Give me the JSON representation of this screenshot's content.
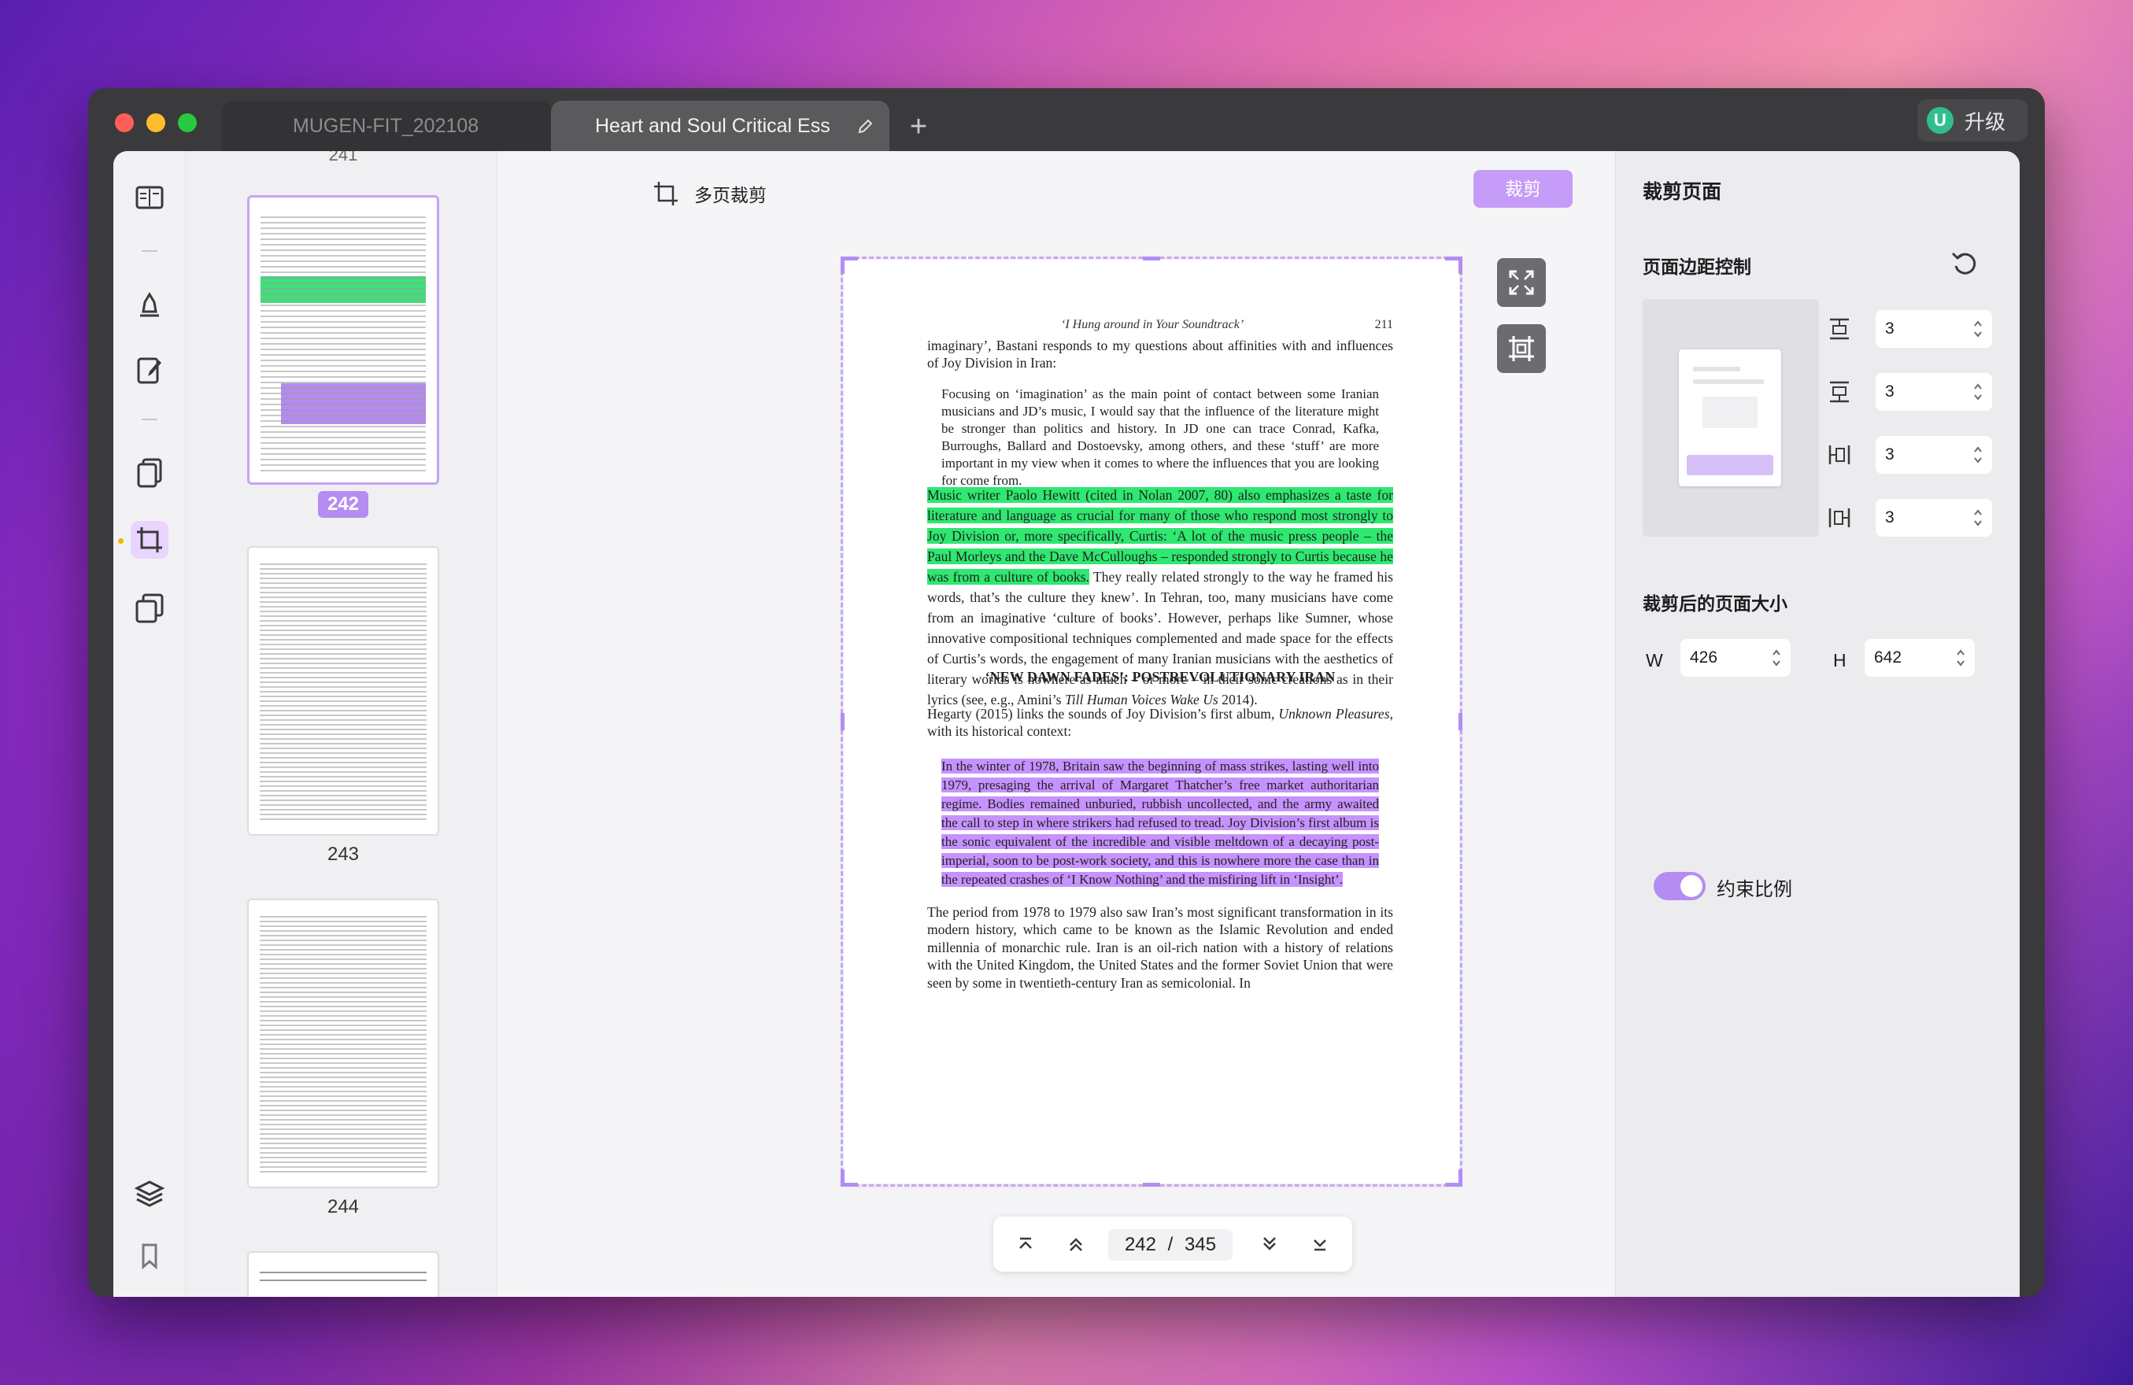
{
  "window": {
    "tabs": [
      {
        "label": "MUGEN-FIT_202108"
      },
      {
        "label": "Heart and Soul Critical Ess"
      }
    ],
    "upgrade": {
      "badge": "U",
      "label": "升级"
    }
  },
  "toolbar": {
    "title": "多页裁剪",
    "crop_button": "裁剪"
  },
  "thumbnails": {
    "top_label": "241",
    "items": [
      {
        "page": "242",
        "selected": true
      },
      {
        "page": "243",
        "selected": false
      },
      {
        "page": "244",
        "selected": false
      }
    ]
  },
  "document": {
    "running_head_title": "‘I Hung around in Your Soundtrack’",
    "running_head_page": "211",
    "para1": "imaginary’, Bastani responds to my questions about affinities with and influences of Joy Division in Iran:",
    "quote1": "Focusing on ‘imagination’ as the main point of contact between some Iranian musicians and JD’s music, I would say that the influence of the literature might be stronger than politics and history. In JD one can trace Conrad, Kafka, Burroughs, Ballard and Dostoevsky, among others, and these ‘stuff’ are more important in my view when it comes to where the influences that you are looking for come from.",
    "para2_highlight": "Music writer Paolo Hewitt (cited in Nolan 2007, 80) also emphasizes a taste for literature and language as crucial for many of those who respond most strongly to Joy Division or, more specifically, Curtis: ‘A lot of the music press people – the Paul Morleys and the Dave McCulloughs – responded strongly to Curtis because he was from a culture of books.",
    "para2_rest": " They really related strongly to the way he framed his words, that’s the culture they knew’. In Tehran, too, many musicians have come from an imaginative ‘culture of books’. However, perhaps like Sumner, whose innovative compositional techniques complemented and made space for the effects of Curtis’s words, the engagement of many Iranian musicians with the aesthetics of literary worlds is nowhere as much – or more – in their sonic creations as in their lyrics (see, e.g., Amini’s ",
    "para2_italic": "Till Human Voices Wake Us",
    "para2_end": " 2014).",
    "section_heading": "‘NEW DAWN FADES’: POSTREVOLUTIONARY IRAN",
    "para3_start": "Hegarty (2015) links the sounds of Joy Division’s first album, ",
    "para3_italic": "Unknown Pleasures",
    "para3_end": ", with its historical context:",
    "quote2_highlight": "In the winter of 1978, Britain saw the beginning of mass strikes, lasting well into 1979, presaging the arrival of Margaret Thatcher’s free market authoritarian regime. Bodies remained unburied, rubbish uncollected, and the army awaited the call to step in where strikers had refused to tread. Joy Division’s first album is the sonic equivalent of the incredible and visible meltdown of a decaying post-imperial, soon to be post-work society, and this is nowhere more the case than in the repeated crashes of ‘I Know Nothing’ and the misfiring lift in ‘Insight’.",
    "para4": "The period from 1978 to 1979 also saw Iran’s most significant transformation in its modern history, which came to be known as the Islamic Revolution and ended millennia of monarchic rule. Iran is an oil-rich nation with a history of relations with the United Kingdom, the United States and the former Soviet Union that were seen by some in twentieth-century Iran as semicolonial. In"
  },
  "pager": {
    "current": "242",
    "separator": "/",
    "total": "345"
  },
  "panel": {
    "title": "裁剪页面",
    "margin_heading": "页面边距控制",
    "margins": {
      "top": "3",
      "bottom": "3",
      "left": "3",
      "right": "3"
    },
    "size_heading": "裁剪后的页面大小",
    "width_label": "W",
    "width_value": "426",
    "height_label": "H",
    "height_value": "642",
    "constrain_label": "约束比例",
    "constrain_on": true
  },
  "colors": {
    "accent": "#b48cf2",
    "highlight_green": "#2ee870",
    "highlight_purple": "#c692ff"
  }
}
